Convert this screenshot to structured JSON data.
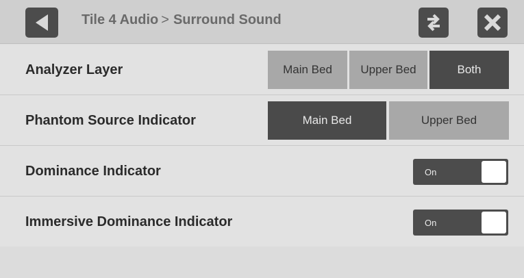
{
  "header": {
    "breadcrumb_parent": "Tile 4 Audio",
    "breadcrumb_separator": ">",
    "breadcrumb_current": "Surround Sound",
    "back_icon": "back-triangle-icon",
    "swap_icon": "swap-arrows-icon",
    "close_icon": "close-x-icon"
  },
  "settings": {
    "analyzer_layer": {
      "label": "Analyzer Layer",
      "options": [
        "Main Bed",
        "Upper Bed",
        "Both"
      ],
      "selected": "Both"
    },
    "phantom_source": {
      "label": "Phantom Source Indicator",
      "options": [
        "Main Bed",
        "Upper Bed"
      ],
      "selected": "Main Bed"
    },
    "dominance": {
      "label": "Dominance Indicator",
      "state_label": "On"
    },
    "immersive_dominance": {
      "label": "Immersive Dominance Indicator",
      "state_label": "On"
    }
  },
  "colors": {
    "selected_segment": "#4a4a4a",
    "unselected_segment": "#a8a8a8",
    "header_button": "#4c4c4c"
  }
}
